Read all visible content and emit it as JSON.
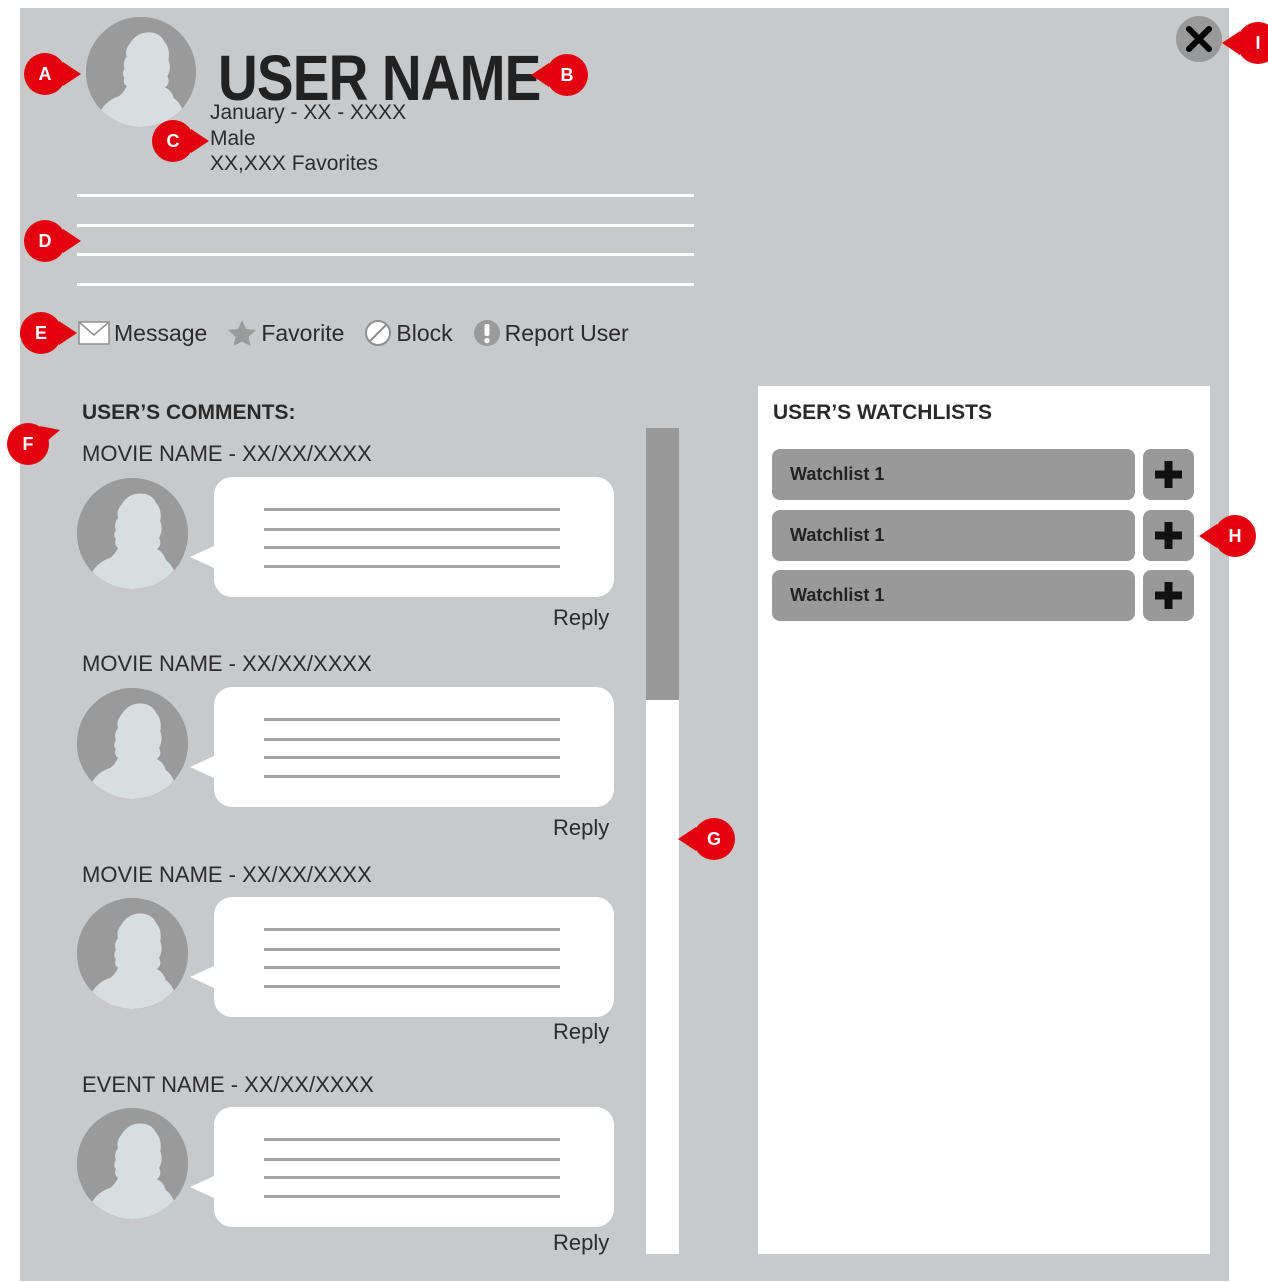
{
  "profile": {
    "user_name": "USER NAME",
    "birthdate": "January - XX - XXXX",
    "gender": "Male",
    "favorites": "XX,XXX Favorites"
  },
  "actions": [
    {
      "label": "Message",
      "icon": "envelope-icon"
    },
    {
      "label": "Favorite",
      "icon": "star-icon"
    },
    {
      "label": "Block",
      "icon": "block-icon"
    },
    {
      "label": "Report User",
      "icon": "exclamation-icon"
    }
  ],
  "comments": {
    "heading": "USER’S COMMENTS:",
    "items": [
      {
        "title": "MOVIE NAME - XX/XX/XXXX",
        "reply_label": "Reply"
      },
      {
        "title": "MOVIE NAME - XX/XX/XXXX",
        "reply_label": "Reply"
      },
      {
        "title": "MOVIE NAME - XX/XX/XXXX",
        "reply_label": "Reply"
      },
      {
        "title": "EVENT NAME - XX/XX/XXXX",
        "reply_label": "Reply"
      }
    ]
  },
  "watchlists": {
    "heading": "USER’S WATCHLISTS",
    "items": [
      {
        "label": "Watchlist 1"
      },
      {
        "label": "Watchlist 1"
      },
      {
        "label": "Watchlist 1"
      }
    ]
  },
  "annotations": [
    "A",
    "B",
    "C",
    "D",
    "E",
    "F",
    "G",
    "H",
    "I"
  ],
  "colors": {
    "panel": "#c8c9cb",
    "control_gray": "#999999",
    "marker_red": "#e3000f",
    "white": "#ffffff"
  }
}
